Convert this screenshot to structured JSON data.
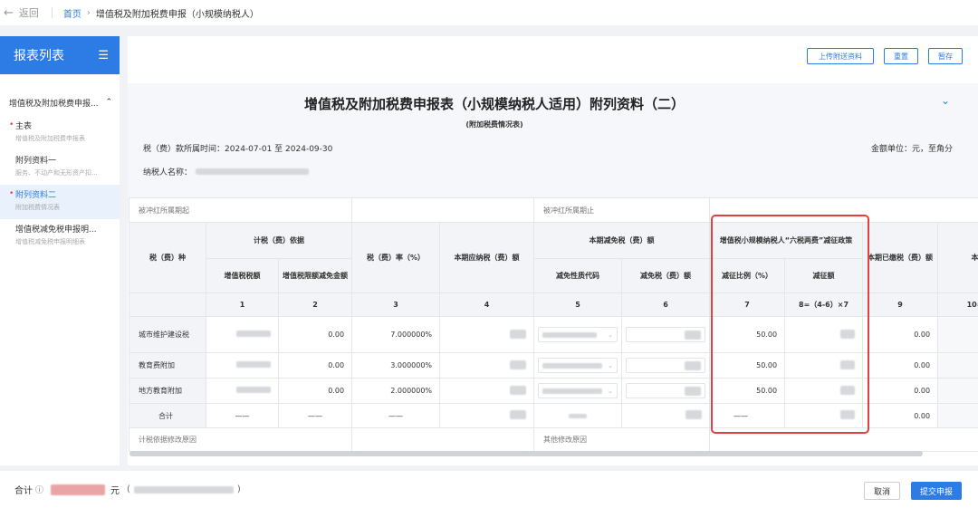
{
  "topbar": {
    "back_label": "返回",
    "home": "首页",
    "breadcrumb_current": "增值税及附加税费申报（小规模纳税人）"
  },
  "sidebar": {
    "title": "报表列表",
    "group_label": "增值税及附加税费申报...",
    "items": [
      {
        "name": "主表",
        "sub": "增值税及附加税费申报表",
        "required": true,
        "active": false
      },
      {
        "name": "附列资料一",
        "sub": "服务、不动产和无形资产扣...",
        "required": false,
        "active": false
      },
      {
        "name": "附列资料二",
        "sub": "附加税费情况表",
        "required": true,
        "active": true
      },
      {
        "name": "增值税减免税申报明...",
        "sub": "增值税减免税申报明细表",
        "required": false,
        "active": false
      }
    ]
  },
  "toolbar": {
    "upload_label": "上传附送资料",
    "reset_label": "重置",
    "save_label": "暂存"
  },
  "form": {
    "title": "增值税及附加税费申报表（小规模纳税人适用）附列资料（二）",
    "subtitle": "(附加税费情况表)",
    "period_label": "税（费）款所属时间：",
    "period_value": "2024-07-01 至 2024-09-30",
    "unit_label": "金额单位：元，至角分",
    "payer_label": "纳税人名称："
  },
  "table": {
    "offset_start_label": "被冲红所属期起",
    "offset_end_label": "被冲红所属期止",
    "headers": {
      "tax_type": "税（费）种",
      "basis_group": "计税（费）依据",
      "vat_amount": "增值税税额",
      "vat_credit_deduction": "增值税限额减免金额",
      "rate": "税（费）率（%）",
      "payable": "本期应纳税（费）额",
      "exempt_group": "本期减免税（费）额",
      "exempt_code": "减免性质代码",
      "exempt_amount": "减免税（费）额",
      "six_tax_group": "增值税小规模纳税人“六税两费”减征政策",
      "reduction_ratio": "减征比例（%）",
      "reduction_amount": "减征额",
      "paid": "本期已缴税（费）额",
      "col10_partial": "本"
    },
    "col_indices": [
      "1",
      "2",
      "3",
      "4",
      "5",
      "6",
      "7",
      "8=（4-6）×7",
      "9",
      "10="
    ],
    "rows": [
      {
        "name": "城市维护建设税",
        "deduction": "0.00",
        "rate": "7.000000%",
        "ratio": "50.00",
        "paid": "0.00"
      },
      {
        "name": "教育费附加",
        "deduction": "0.00",
        "rate": "3.000000%",
        "ratio": "50.00",
        "paid": "0.00"
      },
      {
        "name": "地方教育附加",
        "deduction": "0.00",
        "rate": "2.000000%",
        "ratio": "50.00",
        "paid": "0.00"
      }
    ],
    "total_row": {
      "name": "合计",
      "dash": "——",
      "paid": "0.00"
    },
    "basis_change_reason_label": "计税依据修改原因",
    "other_change_reason_label": "其他修改原因"
  },
  "bottom": {
    "total_label": "合计",
    "currency": "元",
    "cancel_label": "取消",
    "submit_label": "提交申报"
  },
  "colors": {
    "accent": "#2d7be5",
    "highlight_box": "#e04040"
  }
}
